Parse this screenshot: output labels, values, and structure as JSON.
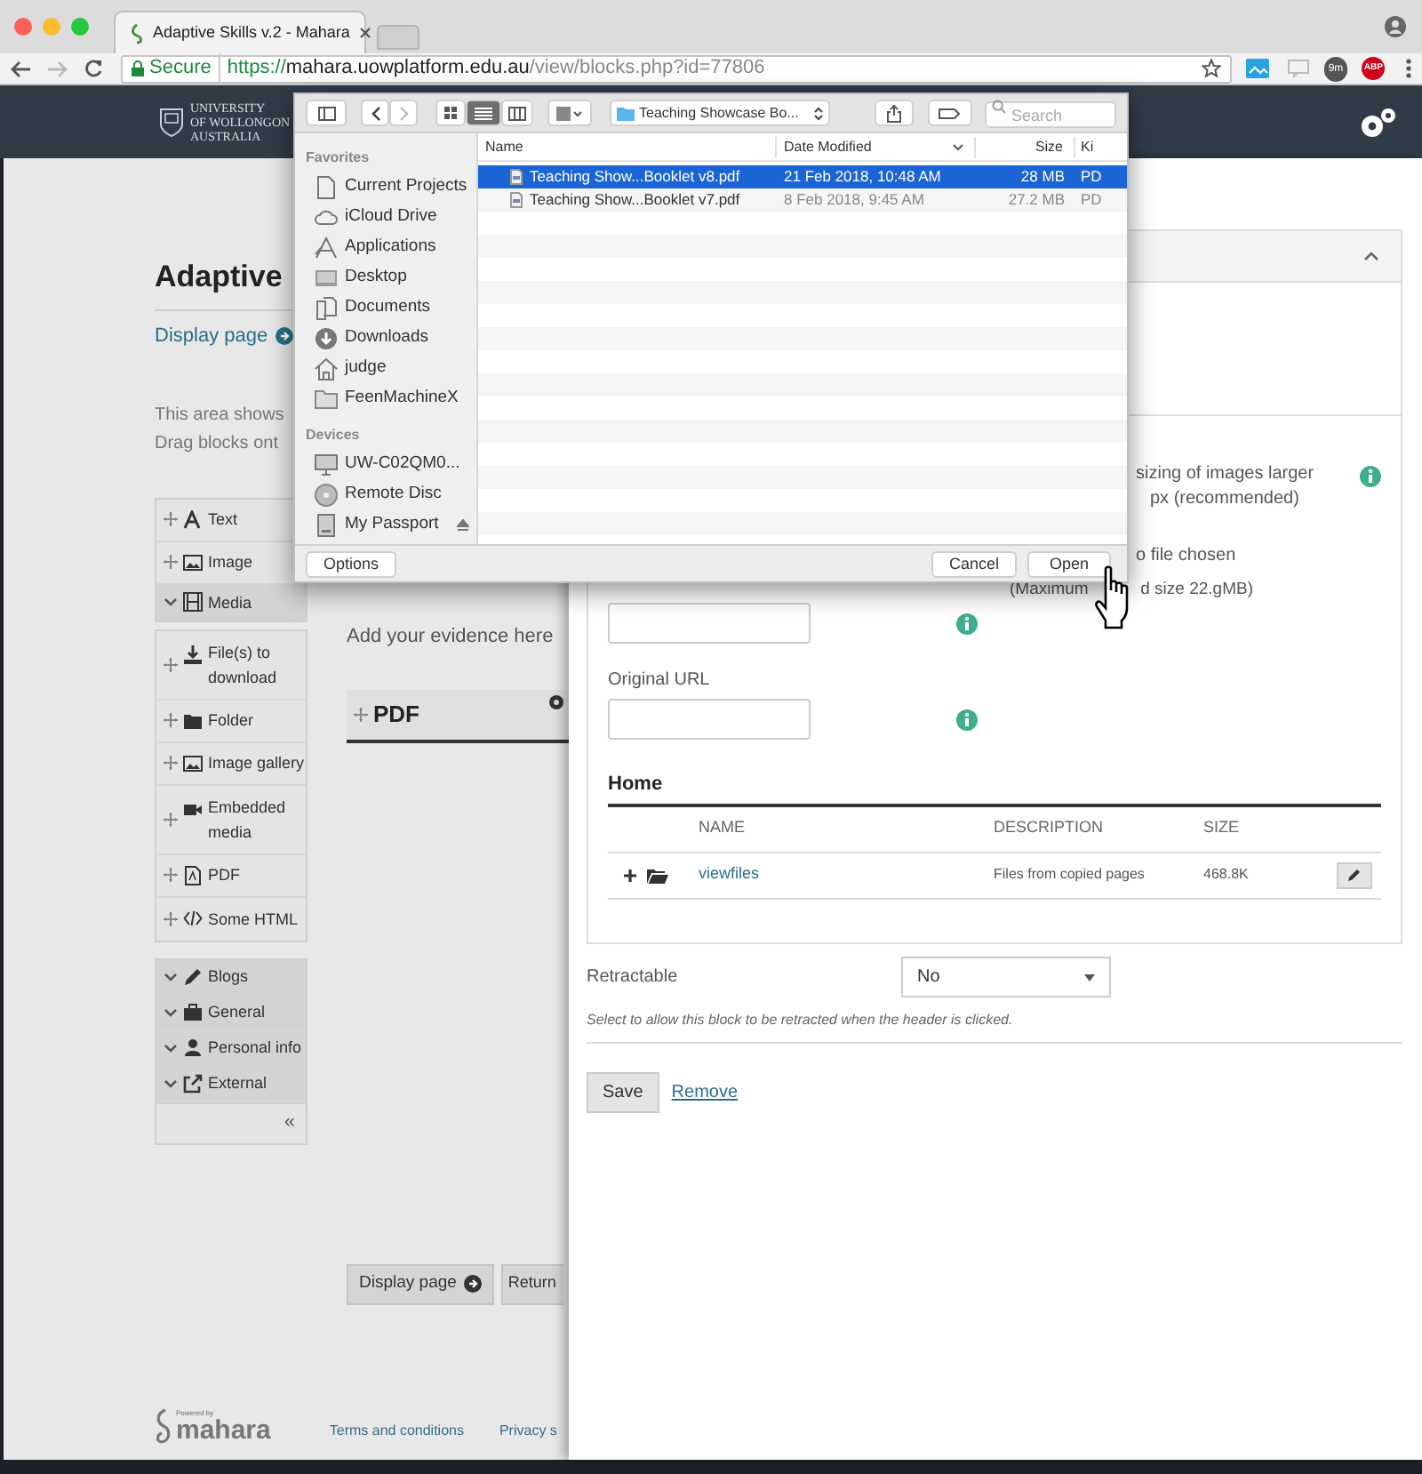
{
  "browser": {
    "tab_title": "Adaptive Skills v.2 - Mahara",
    "url": {
      "secure": "Secure",
      "scheme": "https://",
      "host": "mahara.uowplatform.edu.au",
      "path": "/view/blocks.php?id=77806"
    },
    "extension_badge": "9m",
    "adblock_badge": "ABP"
  },
  "site_header": {
    "logo_lines": [
      "UNIVERSITY",
      "OF WOLLONGON",
      "AUSTRALIA"
    ]
  },
  "page": {
    "title": "Adaptive",
    "display_link": "Display page",
    "intro_lines": [
      "This area shows",
      "Drag blocks ont"
    ],
    "palette": [
      {
        "kind": "block",
        "label": "Text"
      },
      {
        "kind": "block",
        "label": "Image"
      },
      {
        "kind": "category",
        "label": "Media",
        "expanded": true,
        "children": [
          "File(s) to download",
          "Folder",
          "Image gallery",
          "Embedded media",
          "PDF",
          "Some HTML"
        ]
      },
      {
        "kind": "category",
        "label": "Blogs",
        "expanded": false
      },
      {
        "kind": "category",
        "label": "General",
        "expanded": false
      },
      {
        "kind": "category",
        "label": "Personal info",
        "expanded": false
      },
      {
        "kind": "category",
        "label": "External",
        "expanded": false
      }
    ],
    "collapse": "«",
    "evidence_hint": "Add your evidence here",
    "block_title": "PDF",
    "buttons": [
      "Display page",
      "Return"
    ]
  },
  "footer": {
    "powered_by": "Powered by",
    "brand": "mahara",
    "links": [
      "Terms and conditions",
      "Privacy s"
    ]
  },
  "panel": {
    "resize_note_lines": [
      "sizing of images larger",
      "px (recommended)"
    ],
    "file_status": "o file chosen",
    "max_size_parts": [
      "(Maximum",
      "d size 22.gMB)"
    ],
    "original_url_label": "Original URL",
    "folder": {
      "title": "Home",
      "columns": [
        "NAME",
        "DESCRIPTION",
        "SIZE"
      ],
      "rows": [
        {
          "name": "viewfiles",
          "description": "Files from copied pages",
          "size": "468.8K"
        }
      ]
    },
    "retractable": {
      "label": "Retractable",
      "value": "No",
      "help": "Select to allow this block to be retracted when the header is clicked."
    },
    "save": "Save",
    "remove": "Remove"
  },
  "dialog": {
    "location": "Teaching Showcase Bo...",
    "search_placeholder": "Search",
    "sidebar": [
      {
        "title": "Favorites",
        "items": [
          {
            "label": "Current Projects"
          },
          {
            "label": "iCloud Drive"
          },
          {
            "label": "Applications"
          },
          {
            "label": "Desktop"
          },
          {
            "label": "Documents"
          },
          {
            "label": "Downloads"
          },
          {
            "label": "judge"
          },
          {
            "label": "FeenMachineX"
          }
        ]
      },
      {
        "title": "Devices",
        "items": [
          {
            "label": "UW-C02QM0...",
            "ejectable": false
          },
          {
            "label": "Remote Disc",
            "ejectable": false
          },
          {
            "label": "My Passport",
            "ejectable": true
          }
        ]
      }
    ],
    "columns": [
      "Name",
      "Date Modified",
      "Size",
      "Ki"
    ],
    "rows": [
      {
        "name": "Teaching Show...Booklet v8.pdf",
        "date": "21 Feb 2018, 10:48 AM",
        "size": "28 MB",
        "kind": "PD",
        "selected": true
      },
      {
        "name": "Teaching Show...Booklet v7.pdf",
        "date": "8 Feb 2018, 9:45 AM",
        "size": "27.2 MB",
        "kind": "PD",
        "selected": false
      }
    ],
    "buttons": {
      "options": "Options",
      "cancel": "Cancel",
      "open": "Open"
    }
  }
}
